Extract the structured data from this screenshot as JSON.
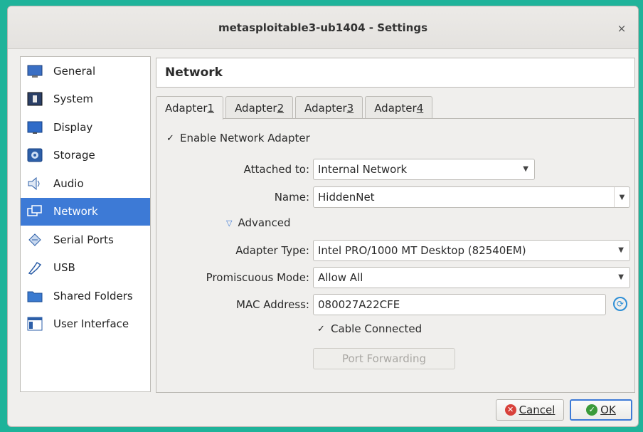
{
  "window": {
    "title": "metasploitable3-ub1404 - Settings",
    "close_glyph": "×"
  },
  "sidebar": {
    "items": [
      {
        "label": "General",
        "icon": "general-icon"
      },
      {
        "label": "System",
        "icon": "system-icon"
      },
      {
        "label": "Display",
        "icon": "display-icon"
      },
      {
        "label": "Storage",
        "icon": "storage-icon"
      },
      {
        "label": "Audio",
        "icon": "audio-icon"
      },
      {
        "label": "Network",
        "icon": "network-icon",
        "selected": true
      },
      {
        "label": "Serial Ports",
        "icon": "serial-ports-icon"
      },
      {
        "label": "USB",
        "icon": "usb-icon"
      },
      {
        "label": "Shared Folders",
        "icon": "shared-folders-icon"
      },
      {
        "label": "User Interface",
        "icon": "user-interface-icon"
      }
    ]
  },
  "section_title": "Network",
  "tabs": [
    {
      "label": "Adapter ",
      "num": "1",
      "active": true
    },
    {
      "label": "Adapter ",
      "num": "2"
    },
    {
      "label": "Adapter ",
      "num": "3"
    },
    {
      "label": "Adapter ",
      "num": "4"
    }
  ],
  "adapter": {
    "enable_label": "Enable Network Adapter",
    "enable_checked": true,
    "attached_label": "Attached to:",
    "attached_value": "Internal Network",
    "name_label": "Name:",
    "name_value": "HiddenNet",
    "advanced_label": "Advanced",
    "adapter_type_label": "Adapter Type:",
    "adapter_type_value": "Intel PRO/1000 MT Desktop (82540EM)",
    "promiscuous_label": "Promiscuous Mode:",
    "promiscuous_value": "Allow All",
    "mac_label": "MAC Address:",
    "mac_value": "080027A22CFE",
    "cable_label": "Cable Connected",
    "cable_checked": true,
    "port_forwarding_label": "Port Forwarding"
  },
  "buttons": {
    "cancel": "Cancel",
    "ok": "OK"
  },
  "colors": {
    "accent": "#3d7ad6",
    "cancel_icon": "#d8413a",
    "ok_icon": "#3a9a3a",
    "frame": "#1fb39a"
  }
}
